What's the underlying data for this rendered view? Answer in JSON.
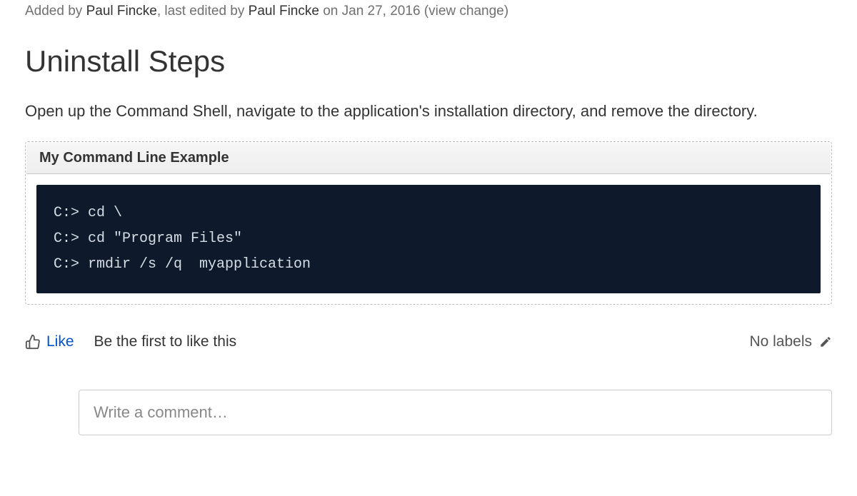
{
  "meta": {
    "added_prefix": "Added by ",
    "author1": "Paul Fincke",
    "middle": ", last edited by ",
    "author2": "Paul Fincke",
    "on": " on ",
    "date": "Jan 27, 2016",
    "spacer": "  (",
    "view_change": "view change",
    "closer": ")"
  },
  "page": {
    "title": "Uninstall Steps",
    "body": "Open up the Command Shell, navigate to the application's installation directory, and remove the directory."
  },
  "code_panel": {
    "header": "My Command Line Example",
    "code": "C:> cd \\\nC:> cd \"Program Files\"\nC:> rmdir /s /q  myapplication"
  },
  "footer": {
    "like_label": "Like",
    "like_stats": "Be the first to like this",
    "no_labels": "No labels"
  },
  "comment": {
    "placeholder": "Write a comment…"
  }
}
